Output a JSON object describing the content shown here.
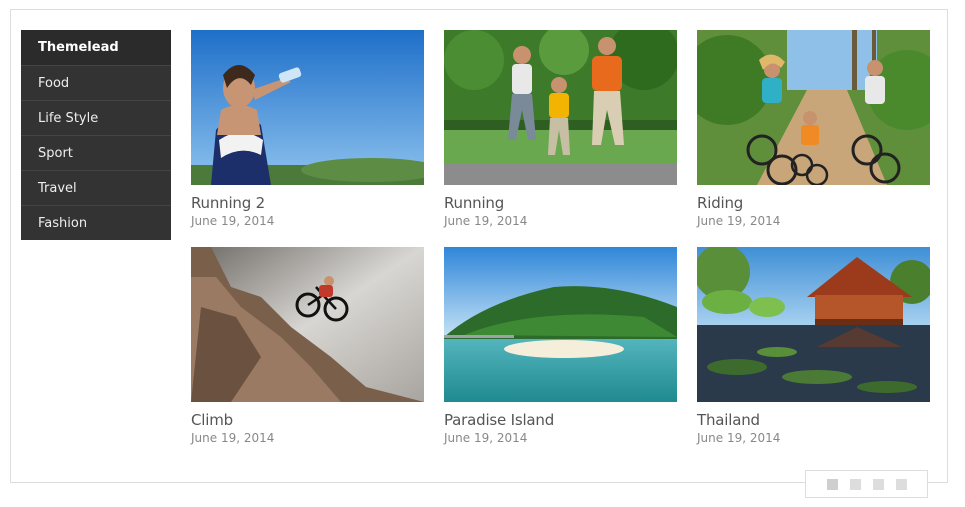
{
  "sidebar": {
    "items": [
      {
        "label": "Themelead"
      },
      {
        "label": "Food"
      },
      {
        "label": "Life Style"
      },
      {
        "label": "Sport"
      },
      {
        "label": "Travel"
      },
      {
        "label": "Fashion"
      }
    ]
  },
  "posts": [
    {
      "title": "Running 2",
      "date": "June 19, 2014"
    },
    {
      "title": "Running",
      "date": "June 19, 2014"
    },
    {
      "title": "Riding",
      "date": "June 19, 2014"
    },
    {
      "title": "Climb",
      "date": "June 19, 2014"
    },
    {
      "title": "Paradise Island",
      "date": "June 19, 2014"
    },
    {
      "title": "Thailand",
      "date": "June 19, 2014"
    }
  ],
  "pager": {
    "pages": 4,
    "active_page": 1
  }
}
